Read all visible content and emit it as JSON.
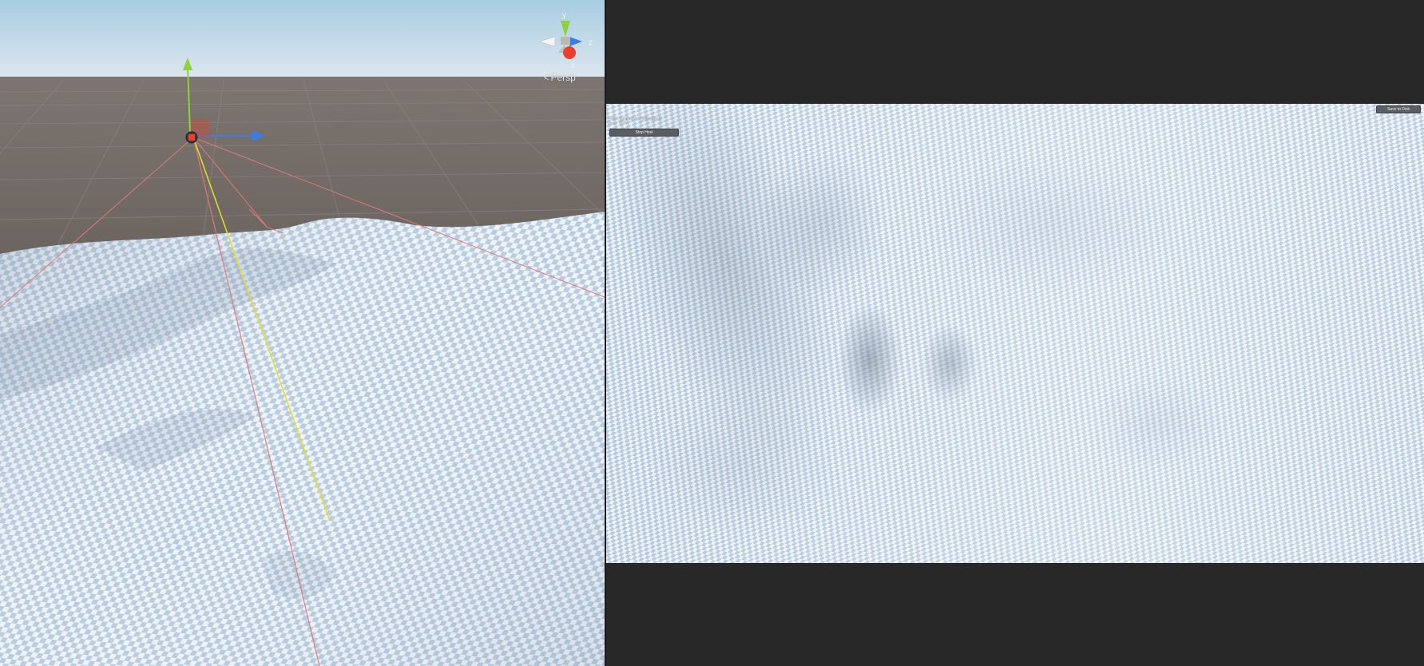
{
  "scene_view": {
    "gizmo": {
      "axis_y": "y",
      "axis_z": "z",
      "axis_x": "x"
    },
    "projection_label": "Persp",
    "projection_icon": "persp-chevron-icon"
  },
  "game_view": {
    "status_line_1": "Host: running via Telepathy. B",
    "status_line_2": "port: 7777",
    "stop_host_label": "Stop Host",
    "save_label": "Save to Disk"
  },
  "colors": {
    "sky_top": "#a8cde2",
    "ground": "#6e6762",
    "terrain_light": "#eef3f9",
    "terrain_check": "#b9cde0",
    "axis_y": "#8cd23c",
    "axis_z": "#3a7de8",
    "axis_x": "#e8402a",
    "frustum": "#e07a7a",
    "ray": "#e6e022"
  }
}
